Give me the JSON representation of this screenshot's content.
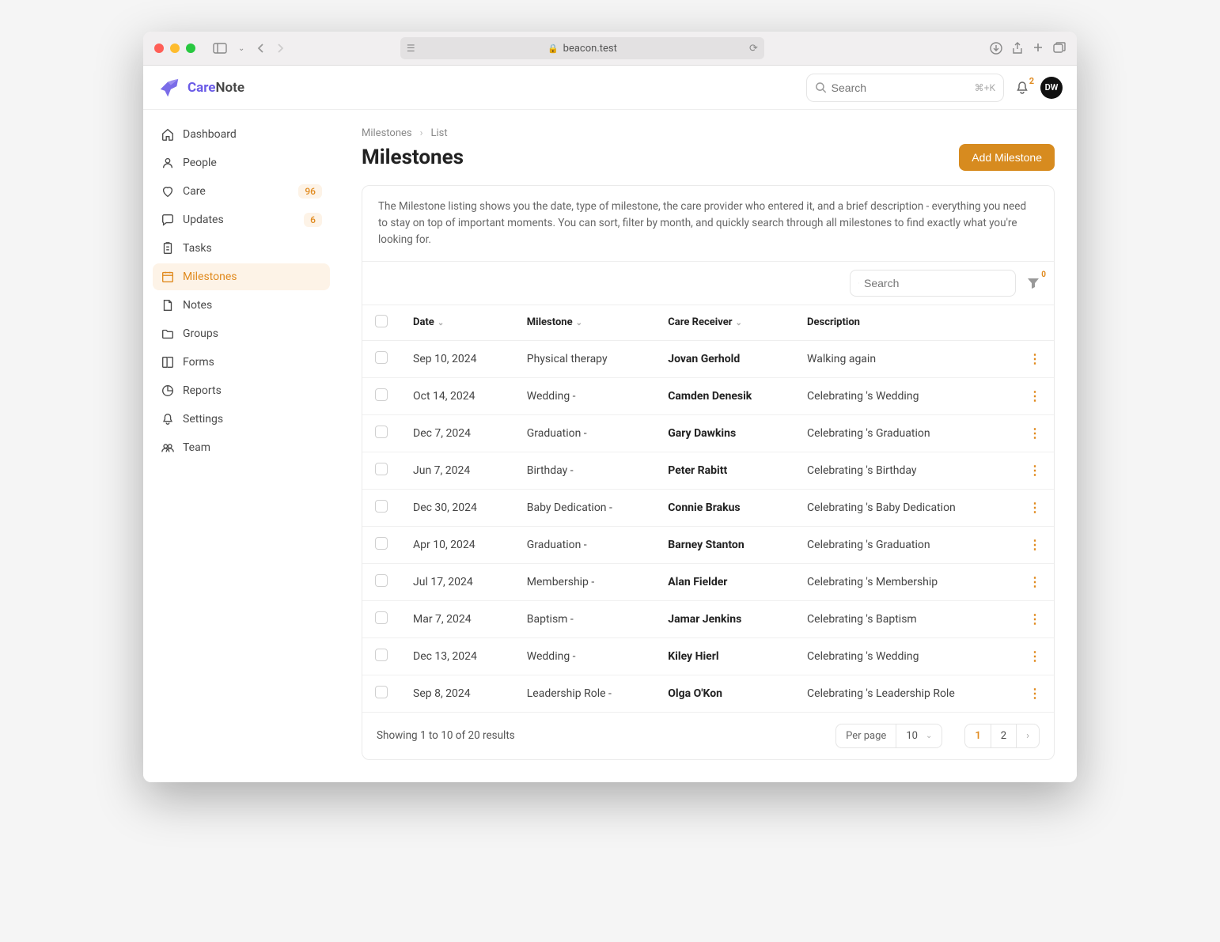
{
  "browser": {
    "url": "beacon.test"
  },
  "brand": {
    "name_part1": "Care",
    "name_part2": "Note"
  },
  "search": {
    "placeholder": "Search",
    "shortcut": "⌘+K"
  },
  "notifications": {
    "count": "2"
  },
  "avatar": {
    "initials": "DW"
  },
  "sidebar": {
    "items": [
      {
        "label": "Dashboard"
      },
      {
        "label": "People"
      },
      {
        "label": "Care",
        "badge": "96"
      },
      {
        "label": "Updates",
        "badge": "6"
      },
      {
        "label": "Tasks"
      },
      {
        "label": "Milestones"
      },
      {
        "label": "Notes"
      },
      {
        "label": "Groups"
      },
      {
        "label": "Forms"
      },
      {
        "label": "Reports"
      },
      {
        "label": "Settings"
      },
      {
        "label": "Team"
      }
    ]
  },
  "breadcrumb": {
    "parent": "Milestones",
    "current": "List"
  },
  "page": {
    "title": "Milestones",
    "add_button": "Add Milestone"
  },
  "info": "The Milestone listing shows you the date, type of milestone, the care provider who entered it, and a brief description - everything you need to stay on top of important moments. You can sort, filter by month, and quickly search through all milestones to find exactly what you're looking for.",
  "table": {
    "search_placeholder": "Search",
    "filter_count": "0",
    "columns": {
      "date": "Date",
      "milestone": "Milestone",
      "receiver": "Care Receiver",
      "description": "Description"
    },
    "rows": [
      {
        "date": "Sep 10, 2024",
        "milestone": "Physical therapy",
        "receiver": "Jovan Gerhold",
        "description": "Walking again"
      },
      {
        "date": "Oct 14, 2024",
        "milestone": "Wedding -",
        "receiver": "Camden Denesik",
        "description": "Celebrating 's Wedding"
      },
      {
        "date": "Dec 7, 2024",
        "milestone": "Graduation -",
        "receiver": "Gary Dawkins",
        "description": "Celebrating 's Graduation"
      },
      {
        "date": "Jun 7, 2024",
        "milestone": "Birthday -",
        "receiver": "Peter Rabitt",
        "description": "Celebrating 's Birthday"
      },
      {
        "date": "Dec 30, 2024",
        "milestone": "Baby Dedication -",
        "receiver": "Connie Brakus",
        "description": "Celebrating 's Baby Dedication"
      },
      {
        "date": "Apr 10, 2024",
        "milestone": "Graduation -",
        "receiver": "Barney Stanton",
        "description": "Celebrating 's Graduation"
      },
      {
        "date": "Jul 17, 2024",
        "milestone": "Membership -",
        "receiver": "Alan Fielder",
        "description": "Celebrating 's Membership"
      },
      {
        "date": "Mar 7, 2024",
        "milestone": "Baptism -",
        "receiver": "Jamar Jenkins",
        "description": "Celebrating 's Baptism"
      },
      {
        "date": "Dec 13, 2024",
        "milestone": "Wedding -",
        "receiver": "Kiley Hierl",
        "description": "Celebrating 's Wedding"
      },
      {
        "date": "Sep 8, 2024",
        "milestone": "Leadership Role -",
        "receiver": "Olga O'Kon",
        "description": "Celebrating 's Leadership Role"
      }
    ]
  },
  "pagination": {
    "summary": "Showing 1 to 10 of 20 results",
    "per_page_label": "Per page",
    "per_page_value": "10",
    "pages": [
      "1",
      "2"
    ]
  }
}
